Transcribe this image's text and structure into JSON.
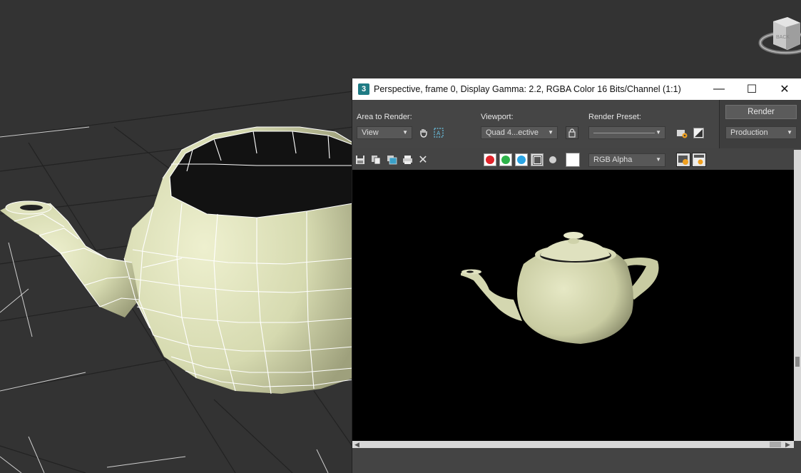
{
  "window": {
    "app_icon_text": "3",
    "title": "Perspective, frame 0, Display Gamma: 2.2, RGBA Color 16 Bits/Channel (1:1)",
    "minimize_glyph": "—",
    "maximize_glyph": "☐",
    "close_glyph": "✕"
  },
  "settings": {
    "area_label": "Area to Render:",
    "area_value": "View",
    "viewport_label": "Viewport:",
    "viewport_value": "Quad 4...ective",
    "preset_label": "Render Preset:",
    "preset_value": "",
    "render_button": "Render",
    "production_value": "Production"
  },
  "toolbar": {
    "channel_value": "RGB Alpha",
    "channel_colors": [
      "#e0242b",
      "#2eb34a",
      "#2aa4e3"
    ]
  },
  "viewcube": {
    "face_label": "BACK"
  }
}
